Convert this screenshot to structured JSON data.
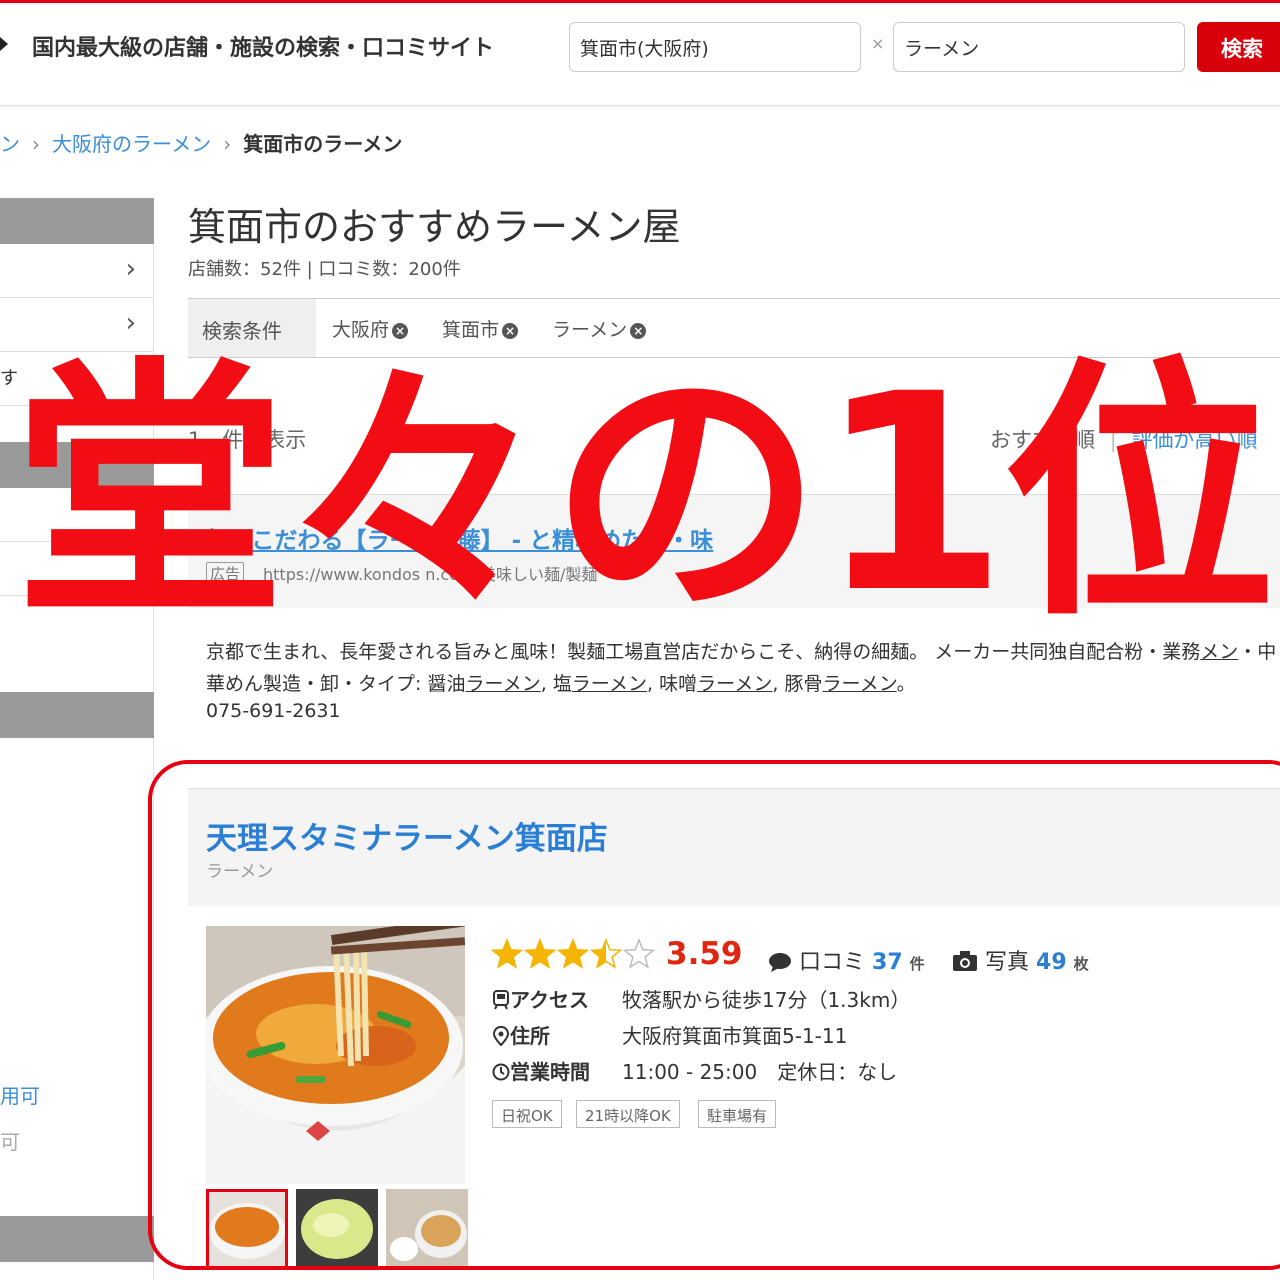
{
  "header": {
    "tagline": "国内最大級の店舗・施設の検索・口コミサイト",
    "area_value": "箕面市(大阪府)",
    "keyword_value": "ラーメン",
    "separator": "×",
    "search_button": "検索"
  },
  "breadcrumb": {
    "items": [
      "ン",
      "大阪府のラーメン"
    ],
    "current": "箕面市のラーメン",
    "separator": "›"
  },
  "sidebar": {
    "partial_items": [
      "す",
      "用可",
      "可"
    ],
    "chevron": "›"
  },
  "main": {
    "title": "箕面市のおすすめラーメン屋",
    "stats": "店舗数：52件 | 口コミ数：200件",
    "conditions_label": "検索条件",
    "conditions": [
      "大阪府",
      "箕面市",
      "ラーメン"
    ],
    "result_count": "1 - 件を表示",
    "sort_options": [
      "おすすめ順",
      "評価が高い順"
    ]
  },
  "ad": {
    "title": "麺にこだわる【ラーメン藤】 - と精魂めた味・味",
    "badge": "広告",
    "url": "https://www.kondos n.com/美味しい麺/製麺",
    "description_parts": [
      {
        "text": "京都で生まれ、長年愛される旨みと風味！製麺工場直営店だからこそ、納得の細麺。 メーカー共同独自配合粉・業務",
        "u": false
      },
      {
        "text": "メン",
        "u": true
      },
      {
        "text": "・中華めん製造・卸・タイプ: 醤油",
        "u": false
      },
      {
        "text": "ラーメン",
        "u": true
      },
      {
        "text": ", 塩",
        "u": false
      },
      {
        "text": "ラーメン",
        "u": true
      },
      {
        "text": ", 味噌",
        "u": false
      },
      {
        "text": "ラーメン",
        "u": true
      },
      {
        "text": ", 豚骨",
        "u": false
      },
      {
        "text": "ラーメン",
        "u": true
      },
      {
        "text": "。",
        "u": false
      }
    ],
    "phone": "075-691-2631"
  },
  "shop": {
    "name": "天理スタミナラーメン箕面店",
    "genre": "ラーメン",
    "rating": 3.5,
    "score": "3.59",
    "review_label": "口コミ",
    "review_count": "37",
    "review_unit": "件",
    "photo_label": "写真",
    "photo_count": "49",
    "photo_unit": "枚",
    "access_label": "アクセス",
    "access_value": "牧落駅から徒歩17分（1.3km）",
    "address_label": "住所",
    "address_value": "大阪府箕面市箕面5-1-11",
    "hours_label": "営業時間",
    "hours_value": "11:00 - 25:00　定休日：なし",
    "tags": [
      "日祝OK",
      "21時以降OK",
      "駐車場有"
    ]
  },
  "overlay": {
    "caption": "堂々の1位",
    "color": "#f20d14"
  },
  "colors": {
    "accent_red": "#e60012",
    "link_blue": "#3a8fd8",
    "star_gold": "#f5b400"
  }
}
